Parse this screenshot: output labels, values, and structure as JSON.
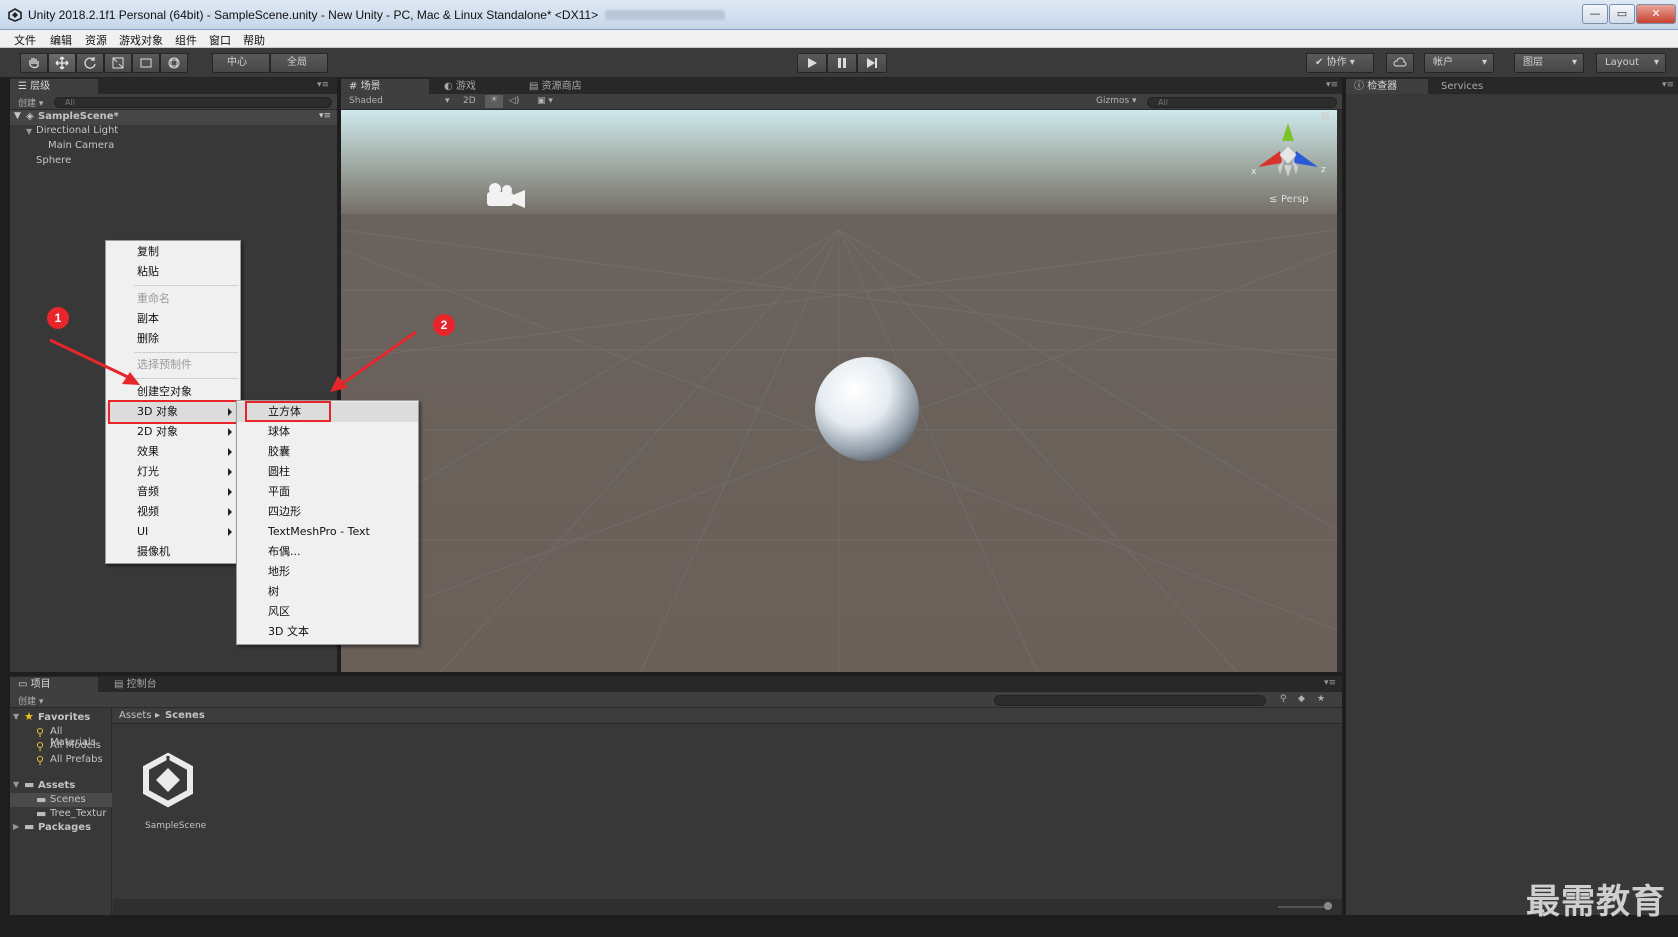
{
  "window": {
    "title": "Unity 2018.2.1f1 Personal (64bit) - SampleScene.unity - New Unity - PC, Mac & Linux Standalone* <DX11>",
    "minimize": "—",
    "maximize": "▭",
    "close": "✕"
  },
  "menubar": [
    "文件",
    "编辑",
    "资源",
    "游戏对象",
    "组件",
    "窗口",
    "帮助"
  ],
  "toolbar": {
    "pivot": "中心",
    "space": "全局",
    "collab": "协作",
    "account": "帐户",
    "layers": "图层",
    "layout": "Layout"
  },
  "hierarchy": {
    "tab": "层级",
    "create": "创建",
    "search_placeholder": "All",
    "scene": "SampleScene*",
    "items": [
      "Directional Light",
      "Main Camera",
      "Sphere"
    ]
  },
  "scene": {
    "tabs": [
      "场景",
      "游戏",
      "资源商店"
    ],
    "shading": "Shaded",
    "mode2d": "2D",
    "gizmos": "Gizmos",
    "search_placeholder": "All",
    "persp": "Persp",
    "axis_x": "x",
    "axis_z": "z"
  },
  "inspector": {
    "tabs": [
      "检查器",
      "Services"
    ]
  },
  "context_menu": {
    "items": [
      {
        "label": "复制",
        "disabled": false
      },
      {
        "label": "粘贴",
        "disabled": false
      },
      {
        "label": "重命名",
        "disabled": true
      },
      {
        "label": "副本",
        "disabled": false
      },
      {
        "label": "删除",
        "disabled": false
      },
      {
        "label": "选择预制件",
        "disabled": true
      },
      {
        "label": "创建空对象",
        "disabled": false
      },
      {
        "label": "3D 对象",
        "disabled": false
      },
      {
        "label": "2D 对象",
        "disabled": false
      },
      {
        "label": "效果",
        "disabled": false
      },
      {
        "label": "灯光",
        "disabled": false
      },
      {
        "label": "音频",
        "disabled": false
      },
      {
        "label": "视频",
        "disabled": false
      },
      {
        "label": "UI",
        "disabled": false
      },
      {
        "label": "摄像机",
        "disabled": false
      }
    ]
  },
  "submenu_3d": {
    "items": [
      "立方体",
      "球体",
      "胶囊",
      "圆柱",
      "平面",
      "四边形",
      "TextMeshPro - Text",
      "布偶...",
      "地形",
      "树",
      "风区",
      "3D 文本"
    ]
  },
  "annotations": [
    "1",
    "2"
  ],
  "project": {
    "tabs": [
      "项目",
      "控制台"
    ],
    "create": "创建",
    "favorites": "Favorites",
    "favorite_items": [
      "All Materials",
      "All Models",
      "All Prefabs"
    ],
    "assets": "Assets",
    "asset_folders": [
      "Scenes",
      "Tree_Textur"
    ],
    "packages": "Packages",
    "breadcrumb": [
      "Assets",
      "Scenes"
    ],
    "file_name": "SampleScene"
  },
  "watermark": "最需教育",
  "colors": {
    "highlight": "#e5262b",
    "badge": "#e8252b",
    "axis_x": "#d8322a",
    "axis_y": "#7cc42a",
    "axis_z": "#2a5ad8"
  }
}
